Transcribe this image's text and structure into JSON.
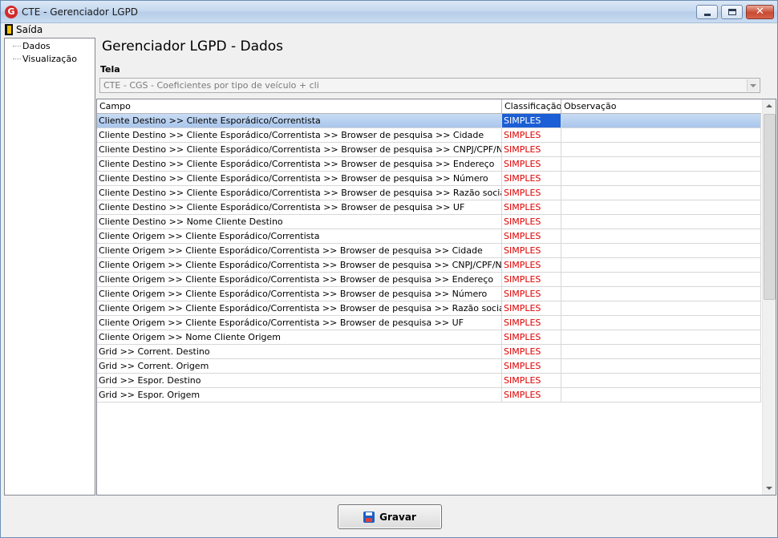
{
  "window": {
    "icon_letter": "G",
    "title": "CTE - Gerenciador LGPD"
  },
  "menu": {
    "items": [
      {
        "label": "Saída",
        "icon": "door-exit-icon"
      }
    ]
  },
  "tree": {
    "items": [
      {
        "label": "Dados"
      },
      {
        "label": "Visualização"
      }
    ]
  },
  "main": {
    "title": "Gerenciador LGPD - Dados",
    "tela_label": "Tela",
    "tela_value": "CTE - CGS - Coeficientes por tipo de veículo + cli"
  },
  "grid": {
    "columns": [
      "Campo",
      "Classificação",
      "Observação"
    ],
    "selected_row": 0,
    "rows": [
      {
        "campo": "Cliente Destino >> Cliente Esporádico/Correntista",
        "classificacao": "SIMPLES",
        "observacao": ""
      },
      {
        "campo": "Cliente Destino >> Cliente Esporádico/Correntista >> Browser de pesquisa >> Cidade",
        "classificacao": "SIMPLES",
        "observacao": ""
      },
      {
        "campo": "Cliente Destino >> Cliente Esporádico/Correntista >> Browser de pesquisa >> CNPJ/CPF/Nr.Cliente",
        "classificacao": "SIMPLES",
        "observacao": ""
      },
      {
        "campo": "Cliente Destino >> Cliente Esporádico/Correntista >> Browser de pesquisa >> Endereço",
        "classificacao": "SIMPLES",
        "observacao": ""
      },
      {
        "campo": "Cliente Destino >> Cliente Esporádico/Correntista >> Browser de pesquisa >> Número",
        "classificacao": "SIMPLES",
        "observacao": ""
      },
      {
        "campo": "Cliente Destino >> Cliente Esporádico/Correntista >> Browser de pesquisa >> Razão social",
        "classificacao": "SIMPLES",
        "observacao": ""
      },
      {
        "campo": "Cliente Destino >> Cliente Esporádico/Correntista >> Browser de pesquisa >> UF",
        "classificacao": "SIMPLES",
        "observacao": ""
      },
      {
        "campo": "Cliente Destino >> Nome Cliente Destino",
        "classificacao": "SIMPLES",
        "observacao": ""
      },
      {
        "campo": "Cliente Origem >> Cliente Esporádico/Correntista",
        "classificacao": "SIMPLES",
        "observacao": ""
      },
      {
        "campo": "Cliente Origem >> Cliente Esporádico/Correntista >> Browser de pesquisa >> Cidade",
        "classificacao": "SIMPLES",
        "observacao": ""
      },
      {
        "campo": "Cliente Origem >> Cliente Esporádico/Correntista >> Browser de pesquisa >> CNPJ/CPF/Nr.Cliente",
        "classificacao": "SIMPLES",
        "observacao": ""
      },
      {
        "campo": "Cliente Origem >> Cliente Esporádico/Correntista >> Browser de pesquisa >> Endereço",
        "classificacao": "SIMPLES",
        "observacao": ""
      },
      {
        "campo": "Cliente Origem >> Cliente Esporádico/Correntista >> Browser de pesquisa >> Número",
        "classificacao": "SIMPLES",
        "observacao": ""
      },
      {
        "campo": "Cliente Origem >> Cliente Esporádico/Correntista >> Browser de pesquisa >> Razão social",
        "classificacao": "SIMPLES",
        "observacao": ""
      },
      {
        "campo": "Cliente Origem >> Cliente Esporádico/Correntista >> Browser de pesquisa >> UF",
        "classificacao": "SIMPLES",
        "observacao": ""
      },
      {
        "campo": "Cliente Origem >> Nome Cliente Origem",
        "classificacao": "SIMPLES",
        "observacao": ""
      },
      {
        "campo": "Grid >> Corrent. Destino",
        "classificacao": "SIMPLES",
        "observacao": ""
      },
      {
        "campo": "Grid >> Corrent. Origem",
        "classificacao": "SIMPLES",
        "observacao": ""
      },
      {
        "campo": "Grid >> Espor. Destino",
        "classificacao": "SIMPLES",
        "observacao": ""
      },
      {
        "campo": "Grid >> Espor. Origem",
        "classificacao": "SIMPLES",
        "observacao": ""
      }
    ]
  },
  "actions": {
    "save_label": "Gravar"
  },
  "colors": {
    "classification_text": "#e00000",
    "selection": "#1b5ed5"
  }
}
